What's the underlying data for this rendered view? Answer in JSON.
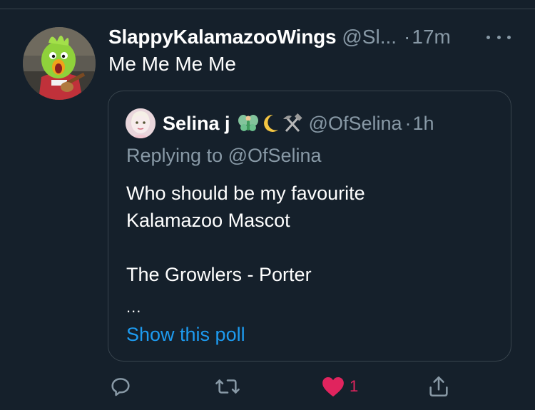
{
  "tweet": {
    "display_name": "SlappyKalamazooWings",
    "handle": "@Sl...",
    "separator": "·",
    "time": "17m",
    "text": "Me Me Me Me"
  },
  "quote": {
    "display_name": "Selina j",
    "emoji_icons": [
      "fairy-icon",
      "crescent-moon-icon",
      "hammer-and-pick-icon"
    ],
    "handle": "@OfSelina",
    "separator": "·",
    "time": "1h",
    "replying_prefix": "Replying to",
    "replying_mention": "@OfSelina",
    "body_lines": [
      "Who should be my favourite",
      "Kalamazoo Mascot",
      "",
      "The Growlers - Porter"
    ],
    "ellipsis": "...",
    "show_poll": "Show this poll"
  },
  "actions": {
    "like_count": "1",
    "liked": true
  },
  "colors": {
    "background": "#15202b",
    "border": "#38444d",
    "secondary_text": "#8899a6",
    "link": "#1d9bf0",
    "like": "#e0245e"
  }
}
